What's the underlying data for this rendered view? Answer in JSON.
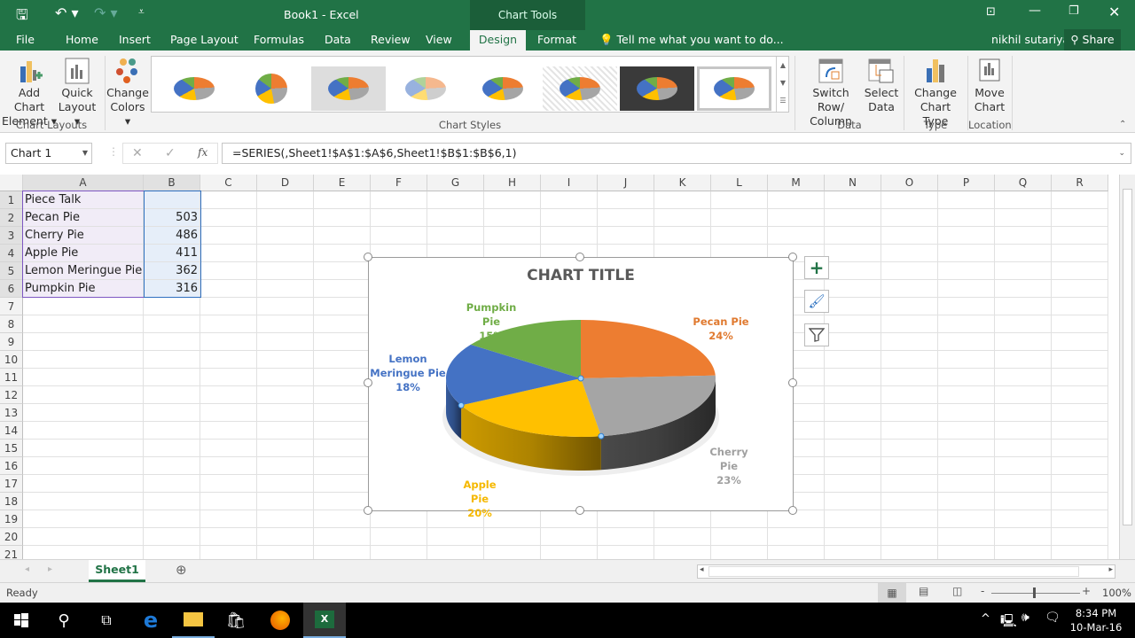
{
  "window": {
    "title": "Book1 - Excel",
    "context_tab": "Chart Tools",
    "user": "nikhil sutariya",
    "share": "Share",
    "tell_me": "Tell me what you want to do..."
  },
  "tabs": [
    "File",
    "Home",
    "Insert",
    "Page Layout",
    "Formulas",
    "Data",
    "Review",
    "View",
    "Design",
    "Format"
  ],
  "active_tab": "Design",
  "ribbon": {
    "add_chart_element": [
      "Add Chart",
      "Element ▾"
    ],
    "quick_layout": [
      "Quick",
      "Layout ▾"
    ],
    "change_colors": [
      "Change",
      "Colors ▾"
    ],
    "chart_layouts_group": "Chart Layouts",
    "chart_styles_group": "Chart Styles",
    "switch_row_col": [
      "Switch Row/",
      "Column"
    ],
    "select_data": [
      "Select",
      "Data"
    ],
    "data_group": "Data",
    "change_chart_type": [
      "Change",
      "Chart Type"
    ],
    "type_group": "Type",
    "move_chart": [
      "Move",
      "Chart"
    ],
    "location_group": "Location"
  },
  "formula_bar": {
    "name_box": "Chart 1",
    "fx": "fx",
    "formula": "=SERIES(,Sheet1!$A$1:$A$6,Sheet1!$B$1:$B$6,1)"
  },
  "columns": [
    "A",
    "B",
    "C",
    "D",
    "E",
    "F",
    "G",
    "H",
    "I",
    "J",
    "K",
    "L",
    "M",
    "N",
    "O",
    "P",
    "Q",
    "R"
  ],
  "rows": [
    "1",
    "2",
    "3",
    "4",
    "5",
    "6",
    "7",
    "8",
    "9",
    "10",
    "11",
    "12",
    "13",
    "14",
    "15",
    "16",
    "17",
    "18",
    "19",
    "20",
    "21"
  ],
  "cells": [
    [
      "Piece Talk",
      ""
    ],
    [
      "Pecan Pie",
      "503"
    ],
    [
      "Cherry Pie",
      "486"
    ],
    [
      "Apple Pie",
      "411"
    ],
    [
      "Lemon Meringue Pie",
      "362"
    ],
    [
      "Pumpkin Pie",
      "316"
    ]
  ],
  "chart_data": {
    "type": "pie",
    "title": "CHART TITLE",
    "categories": [
      "Pecan Pie",
      "Cherry Pie",
      "Apple Pie",
      "Lemon Meringue Pie",
      "Pumpkin Pie"
    ],
    "values": [
      503,
      486,
      411,
      362,
      316
    ],
    "percent_labels": [
      "24%",
      "23%",
      "20%",
      "18%",
      "15%"
    ],
    "colors": [
      "#ED7D31",
      "#A5A5A5",
      "#FFC000",
      "#4472C4",
      "#70AD47"
    ],
    "label_colors": [
      "#E07A30",
      "#A0A0A0",
      "#F5B800",
      "#4472C4",
      "#70AD47"
    ],
    "style": "3d"
  },
  "sheet_tab": "Sheet1",
  "status": {
    "ready": "Ready",
    "zoom": "100%"
  },
  "clock": {
    "time": "8:34 PM",
    "date": "10-Mar-16"
  }
}
